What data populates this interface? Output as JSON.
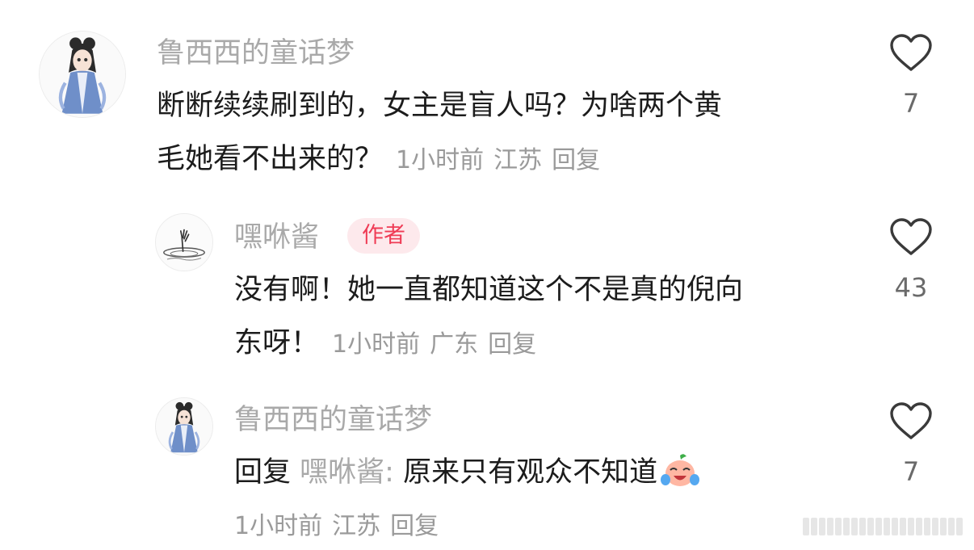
{
  "comments": [
    {
      "author": "鲁西西的童话梦",
      "text": "断断续续刷到的，女主是盲人吗？为啥两个黄毛她看不出来的？",
      "text_line1": "断断续续刷到的，女主是盲人吗？为啥两个黄",
      "text_line2": "毛她看不出来的？",
      "time": "1小时前",
      "location": "江苏",
      "reply_label": "回复",
      "likes": "7",
      "avatar_icon": "girl-hanfu-avatar-icon"
    },
    {
      "author": "嘿咻酱",
      "badge": "作者",
      "text_line1": "没有啊！她一直都知道这个不是真的倪向",
      "text_line2": "东呀！",
      "time": "1小时前",
      "location": "广东",
      "reply_label": "回复",
      "likes": "43",
      "avatar_icon": "ink-hand-avatar-icon"
    },
    {
      "author": "鲁西西的童话梦",
      "reply_prefix": "回复",
      "reply_target": "嘿咻酱:",
      "text": "原来只有观众不知道",
      "emoji": "laughing-crying-peach-emoji",
      "time": "1小时前",
      "location": "江苏",
      "reply_label": "回复",
      "likes": "7",
      "avatar_icon": "girl-hanfu-avatar-icon"
    }
  ],
  "colors": {
    "name": "#a9a9a9",
    "text": "#1c1c1c",
    "meta": "#9a9a9a",
    "badge_bg": "#fde9ec",
    "badge_text": "#ef3b55",
    "heart_stroke": "#3a3a3a"
  },
  "icons": {
    "like": "heart-outline-icon"
  }
}
